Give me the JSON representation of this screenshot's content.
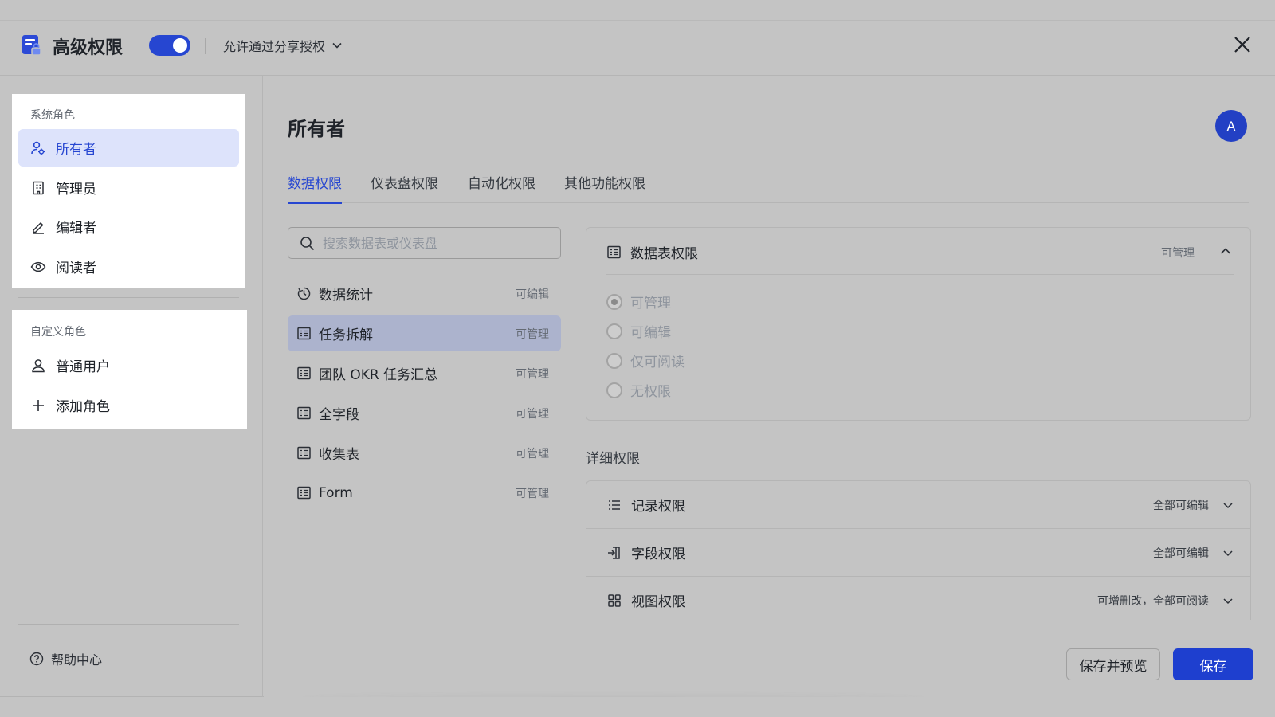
{
  "header": {
    "title": "高级权限",
    "toggle_on": true,
    "share_option": "允许通过分享授权"
  },
  "sidebar": {
    "system_group_label": "系统角色",
    "system_roles": [
      {
        "label": "所有者",
        "icon": "owner-icon",
        "active": true
      },
      {
        "label": "管理员",
        "icon": "building-icon",
        "active": false
      },
      {
        "label": "编辑者",
        "icon": "pencil-icon",
        "active": false
      },
      {
        "label": "阅读者",
        "icon": "eye-icon",
        "active": false
      }
    ],
    "custom_group_label": "自定义角色",
    "custom_roles": [
      {
        "label": "普通用户",
        "icon": "user-icon"
      },
      {
        "label": "添加角色",
        "icon": "plus-icon"
      }
    ],
    "help_label": "帮助中心"
  },
  "main": {
    "title": "所有者",
    "avatar_letter": "A",
    "tabs": [
      {
        "label": "数据权限",
        "active": true
      },
      {
        "label": "仪表盘权限",
        "active": false
      },
      {
        "label": "自动化权限",
        "active": false
      },
      {
        "label": "其他功能权限",
        "active": false
      }
    ],
    "search_placeholder": "搜索数据表或仪表盘",
    "tables": [
      {
        "name": "数据统计",
        "perm": "可编辑",
        "icon": "dashboard-icon",
        "active": false
      },
      {
        "name": "任务拆解",
        "perm": "可管理",
        "icon": "table-icon",
        "active": true
      },
      {
        "name": "团队 OKR 任务汇总",
        "perm": "可管理",
        "icon": "table-icon",
        "active": false
      },
      {
        "name": "全字段",
        "perm": "可管理",
        "icon": "table-icon",
        "active": false
      },
      {
        "name": "收集表",
        "perm": "可管理",
        "icon": "table-icon",
        "active": false
      },
      {
        "name": "Form",
        "perm": "可管理",
        "icon": "table-icon",
        "active": false
      }
    ],
    "table_permission": {
      "title": "数据表权限",
      "status": "可管理",
      "options": [
        {
          "label": "可管理",
          "checked": true
        },
        {
          "label": "可编辑",
          "checked": false
        },
        {
          "label": "仅可阅读",
          "checked": false
        },
        {
          "label": "无权限",
          "checked": false
        }
      ]
    },
    "detail_label": "详细权限",
    "details": [
      {
        "name": "记录权限",
        "value": "全部可编辑",
        "icon": "list-icon"
      },
      {
        "name": "字段权限",
        "value": "全部可编辑",
        "icon": "field-icon"
      },
      {
        "name": "视图权限",
        "value": "可增删改，全部可阅读",
        "icon": "grid-icon"
      }
    ]
  },
  "footer": {
    "save_preview_label": "保存并预览",
    "save_label": "保存"
  },
  "colors": {
    "accent": "#2646d1",
    "backdrop": "#c4c4c4",
    "active_role_bg": "#dde3fb",
    "active_table_bg": "#acb3cd"
  }
}
